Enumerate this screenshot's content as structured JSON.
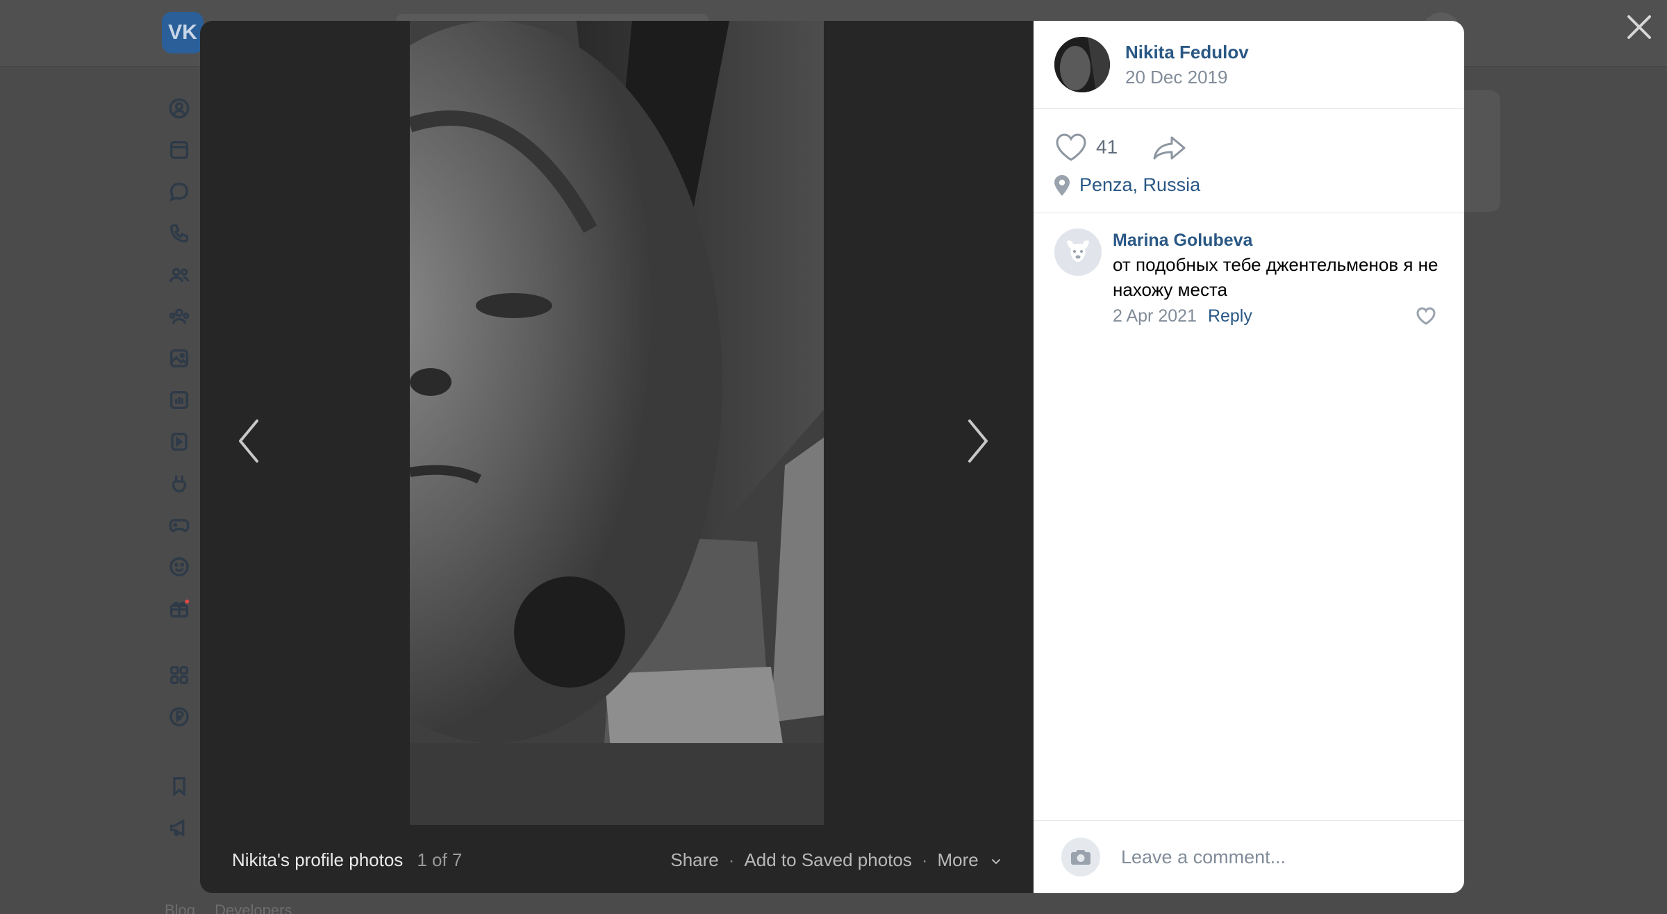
{
  "background": {
    "logo": "VK",
    "footer_links": [
      "Blog",
      "Developers"
    ],
    "sidebar_icons": [
      "profile-icon",
      "news-icon",
      "messenger-icon",
      "calls-icon",
      "friends-icon",
      "communities-icon",
      "photos-icon",
      "music-icon",
      "videos-icon",
      "clips-icon",
      "games-icon",
      "stickers-icon",
      "gifts-icon",
      "apps-icon",
      "payments-icon",
      "bookmarks-icon",
      "ads-icon"
    ]
  },
  "viewer": {
    "album_title": "Nikita's profile photos",
    "photo_count": "1 of 7",
    "actions": {
      "share": "Share",
      "save": "Add to Saved photos",
      "more": "More"
    }
  },
  "post": {
    "author": "Nikita Fedulov",
    "date": "20 Dec 2019",
    "likes": "41",
    "location": "Penza, Russia"
  },
  "comments": [
    {
      "author": "Marina Golubeva",
      "text": "от подобных тебе джентельменов я не нахожу места",
      "date": "2 Apr 2021",
      "reply_label": "Reply"
    }
  ],
  "comment_form": {
    "placeholder": "Leave a comment..."
  },
  "colors": {
    "link": "#2a5885",
    "secondary": "#818c99",
    "viewer_bg": "#262626"
  }
}
